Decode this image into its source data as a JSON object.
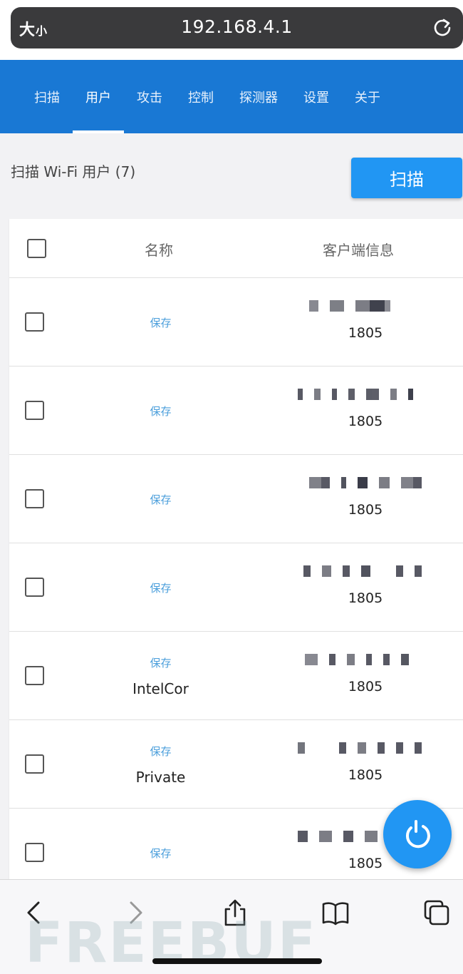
{
  "browser": {
    "text_size_label_large": "大",
    "text_size_label_small": "小",
    "url": "192.168.4.1"
  },
  "nav": {
    "tabs": [
      "扫描",
      "用户",
      "攻击",
      "控制",
      "探测器",
      "设置",
      "关于"
    ],
    "active": "用户"
  },
  "page": {
    "title": "扫描 Wi-Fi 用户 (7)",
    "scan_button_label": "扫描"
  },
  "table": {
    "columns": {
      "name": "名称",
      "client_info": "客户端信息"
    },
    "rows": [
      {
        "save_label": "保存",
        "name": "",
        "vendor": "1805"
      },
      {
        "save_label": "保存",
        "name": "",
        "vendor": "1805"
      },
      {
        "save_label": "保存",
        "name": "",
        "vendor": "1805"
      },
      {
        "save_label": "保存",
        "name": "",
        "vendor": "1805"
      },
      {
        "save_label": "保存",
        "name": "IntelCor",
        "vendor": "1805"
      },
      {
        "save_label": "保存",
        "name": "Private",
        "vendor": "1805"
      },
      {
        "save_label": "保存",
        "name": "",
        "vendor": "1805"
      }
    ]
  },
  "watermark": "FREEBUF",
  "colors": {
    "header_blue": "#1978d4",
    "button_blue": "#2196f3",
    "link_blue": "#4a9edb"
  },
  "icons": {
    "reload": "reload-icon",
    "back": "chevron-left-icon",
    "forward": "chevron-right-icon",
    "share": "share-icon",
    "bookmarks": "book-icon",
    "tabs": "tabs-icon",
    "fab": "refresh-icon"
  }
}
